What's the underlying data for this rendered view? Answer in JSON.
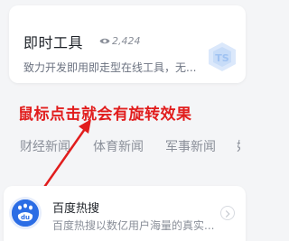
{
  "top_card": {
    "title": "即时工具",
    "views": "2,424",
    "description": "致力开发即用即走型在线工具，无..."
  },
  "annotation": {
    "text": "鼠标点击就会有旋转效果",
    "color": "#e11d1d"
  },
  "tabs": [
    {
      "label": "财经新闻"
    },
    {
      "label": "体育新闻"
    },
    {
      "label": "军事新闻"
    },
    {
      "label": "娱"
    }
  ],
  "list_item": {
    "title": "百度热搜",
    "description": "百度热搜以数亿用户海量的真实..."
  },
  "colors": {
    "brand_blue": "#2b6de5",
    "background": "#f4f5f7"
  },
  "icons": [
    "eye-icon",
    "tool-logo-icon",
    "baidu-du-icon",
    "chevron-right-icon"
  ]
}
